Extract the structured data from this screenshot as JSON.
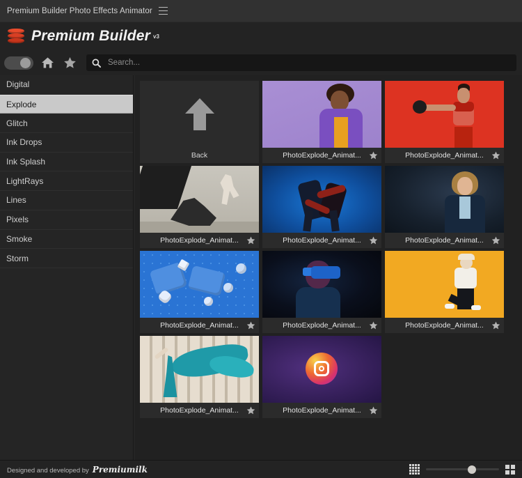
{
  "window": {
    "title": "Premium Builder Photo Effects Animator",
    "menu_icon": "hamburger-menu-icon"
  },
  "brand": {
    "name": "Premium Builder",
    "version": "v3",
    "logo_icon": "stacked-layers-logo-icon"
  },
  "toolbar": {
    "toggle_icon": "toggle-switch",
    "toggle_state": "on",
    "home_icon": "home-icon",
    "favorites_icon": "star-icon",
    "search_icon": "search-icon",
    "search_placeholder": "Search...",
    "search_value": ""
  },
  "sidebar": {
    "items": [
      {
        "label": "Digital",
        "selected": false
      },
      {
        "label": "Explode",
        "selected": true
      },
      {
        "label": "Glitch",
        "selected": false
      },
      {
        "label": "Ink Drops",
        "selected": false
      },
      {
        "label": "Ink Splash",
        "selected": false
      },
      {
        "label": "LightRays",
        "selected": false
      },
      {
        "label": "Lines",
        "selected": false
      },
      {
        "label": "Pixels",
        "selected": false
      },
      {
        "label": "Smoke",
        "selected": false
      },
      {
        "label": "Storm",
        "selected": false
      }
    ]
  },
  "gallery": {
    "back_tile": {
      "label": "Back",
      "icon": "arrow-up-icon"
    },
    "items": [
      {
        "caption": "PhotoExplode_Animat...",
        "art": "a-purple",
        "star_icon": "star-icon"
      },
      {
        "caption": "PhotoExplode_Animat...",
        "art": "a-red",
        "star_icon": "star-icon"
      },
      {
        "caption": "PhotoExplode_Animat...",
        "art": "a-grey",
        "star_icon": "star-icon"
      },
      {
        "caption": "PhotoExplode_Animat...",
        "art": "a-blue",
        "star_icon": "star-icon"
      },
      {
        "caption": "PhotoExplode_Animat...",
        "art": "a-navy",
        "star_icon": "star-icon"
      },
      {
        "caption": "PhotoExplode_Animat...",
        "art": "a-blue3d",
        "star_icon": "star-icon"
      },
      {
        "caption": "PhotoExplode_Animat...",
        "art": "a-vr",
        "star_icon": "star-icon"
      },
      {
        "caption": "PhotoExplode_Animat...",
        "art": "a-orange",
        "star_icon": "star-icon"
      },
      {
        "caption": "PhotoExplode_Animat...",
        "art": "a-col",
        "star_icon": "star-icon"
      },
      {
        "caption": "PhotoExplode_Animat...",
        "art": "a-ig",
        "star_icon": "star-icon"
      }
    ]
  },
  "footer": {
    "credit_text": "Designed and developed by",
    "credit_brand": "Premiumilk",
    "small_grid_icon": "small-grid-view-icon",
    "large_grid_icon": "large-grid-view-icon",
    "zoom_slider_value": 63
  },
  "colors": {
    "accent": "#e2452b",
    "selected_item_bg": "#c9c9c9",
    "titlebar_bg": "#313131",
    "app_bg": "#232323",
    "content_bg": "#212121",
    "tile_bg": "#2b2b2b"
  }
}
